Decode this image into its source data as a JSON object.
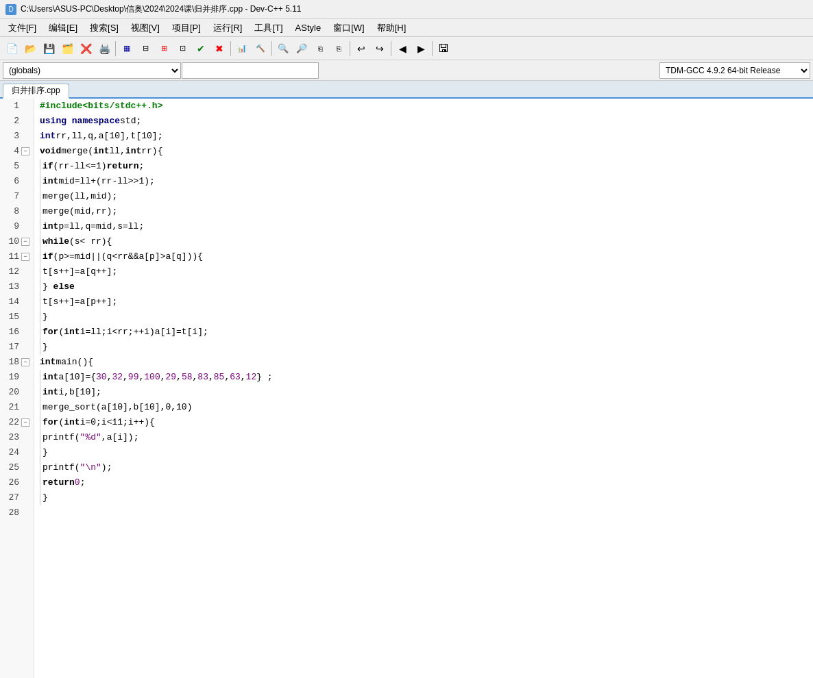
{
  "titleBar": {
    "text": "C:\\Users\\ASUS-PC\\Desktop\\信奥\\2024\\2024课\\归并排序.cpp - Dev-C++ 5.11"
  },
  "menuBar": {
    "items": [
      {
        "label": "文件[F]"
      },
      {
        "label": "编辑[E]"
      },
      {
        "label": "搜索[S]"
      },
      {
        "label": "视图[V]"
      },
      {
        "label": "项目[P]"
      },
      {
        "label": "运行[R]"
      },
      {
        "label": "工具[T]"
      },
      {
        "label": "AStyle"
      },
      {
        "label": "窗口[W]"
      },
      {
        "label": "帮助[H]"
      }
    ]
  },
  "dropdowns": {
    "scope": "(globals)",
    "symbol": "",
    "compiler": "TDM-GCC 4.9.2 64-bit Release"
  },
  "tab": {
    "label": "归并排序.cpp"
  },
  "lines": [
    {
      "num": 1,
      "fold": "",
      "content": "<span class='preprocessor'>#include&lt;bits/stdc++.h&gt;</span>"
    },
    {
      "num": 2,
      "fold": "",
      "content": "<span class='kw'>using namespace</span> <span class='normal'>std;</span>"
    },
    {
      "num": 3,
      "fold": "",
      "content": "<span class='type'>int</span> <span class='normal'>rr,ll,q,a[10],t[10];</span>"
    },
    {
      "num": 4,
      "fold": "minus",
      "content": "<span class='kw-bold'>void</span> <span class='normal'>merge(</span><span class='kw-bold'>int</span> <span class='normal'>ll,</span><span class='kw-bold'>int</span> <span class='normal'>rr){</span>"
    },
    {
      "num": 5,
      "fold": "",
      "content": "        <span class='kw-bold'>if</span><span class='normal'>(rr-ll&lt;=1)</span><span class='kw-bold'>return</span><span class='normal'>;</span>"
    },
    {
      "num": 6,
      "fold": "",
      "content": "        <span class='kw-bold'>int</span> <span class='normal'>mid=ll+(rr-ll&gt;&gt;1);</span>"
    },
    {
      "num": 7,
      "fold": "",
      "content": "        <span class='normal'>merge(ll,mid);</span>"
    },
    {
      "num": 8,
      "fold": "",
      "content": "        <span class='normal'>merge(mid,rr);</span>"
    },
    {
      "num": 9,
      "fold": "",
      "content": "        <span class='kw-bold'>int</span> <span class='normal'>p=ll,q=mid,s=ll;</span>"
    },
    {
      "num": 10,
      "fold": "minus",
      "content": "        <span class='kw-bold'>while</span><span class='normal'>(s&lt; rr){</span>"
    },
    {
      "num": 11,
      "fold": "minus",
      "content": "            <span class='kw-bold'>if</span><span class='normal'>(p&gt;=mid||(q&lt;rr&amp;&amp;a[p]&gt;a[q])){</span>"
    },
    {
      "num": 12,
      "fold": "",
      "content": "                <span class='normal'>t[s++]=a[q++];</span>"
    },
    {
      "num": 13,
      "fold": "",
      "content": "            <span class='normal'>} </span><span class='kw-bold'>else</span>"
    },
    {
      "num": 14,
      "fold": "",
      "content": "        <span class='normal'>t[s++]=a[p++];</span>"
    },
    {
      "num": 15,
      "fold": "",
      "content": "        <span class='normal'>}</span>"
    },
    {
      "num": 16,
      "fold": "",
      "content": "        <span class='kw-bold'>for</span><span class='normal'>(</span><span class='kw-bold'>int</span> <span class='normal'>i=ll;i&lt;rr;++i)a[i]=t[i];</span>"
    },
    {
      "num": 17,
      "fold": "",
      "content": "    <span class='normal'>}</span>"
    },
    {
      "num": 18,
      "fold": "minus",
      "content": "<span class='kw-bold'>int</span> <span class='normal'>main(){</span>"
    },
    {
      "num": 19,
      "fold": "",
      "content": "        <span class='kw-bold'>int</span> <span class='normal'>a[10]={</span><span class='number'>30</span><span class='normal'>,</span><span class='number'>32</span><span class='normal'>,</span><span class='number'>99</span><span class='normal'>,</span><span class='number'>100</span><span class='normal'>,</span><span class='number'>29</span><span class='normal'>,</span><span class='number'>58</span><span class='normal'>,</span><span class='number'>83</span><span class='normal'>,</span><span class='number'>85</span><span class='normal'>,</span><span class='number'>63</span><span class='normal'>,</span><span class='number'>12</span><span class='normal'>} ;</span>"
    },
    {
      "num": 20,
      "fold": "",
      "content": "        <span class='kw-bold'>int</span> <span class='normal'>i,b[10];</span>"
    },
    {
      "num": 21,
      "fold": "",
      "content": "        <span class='normal'>merge_sort(a[10],b[10],0,10)</span>"
    },
    {
      "num": 22,
      "fold": "minus",
      "content": "        <span class='kw-bold'>for</span><span class='normal'>(</span><span class='kw-bold'>int</span> <span class='normal'>i=0;i&lt;11;i++){</span>"
    },
    {
      "num": 23,
      "fold": "",
      "content": "            <span class='normal'>printf(</span><span class='string'>\"%d\"</span><span class='normal'>,a[i]);</span>"
    },
    {
      "num": 24,
      "fold": "",
      "content": "        <span class='normal'>}</span>"
    },
    {
      "num": 25,
      "fold": "",
      "content": "        <span class='normal'>printf(</span><span class='string'>\"\\n\"</span><span class='normal'>);</span>"
    },
    {
      "num": 26,
      "fold": "",
      "content": "        <span class='kw-bold'>return</span> <span class='number'>0</span><span class='normal'>;</span>"
    },
    {
      "num": 27,
      "fold": "",
      "content": "    <span class='normal'>}</span>"
    },
    {
      "num": 28,
      "fold": "",
      "content": ""
    }
  ]
}
